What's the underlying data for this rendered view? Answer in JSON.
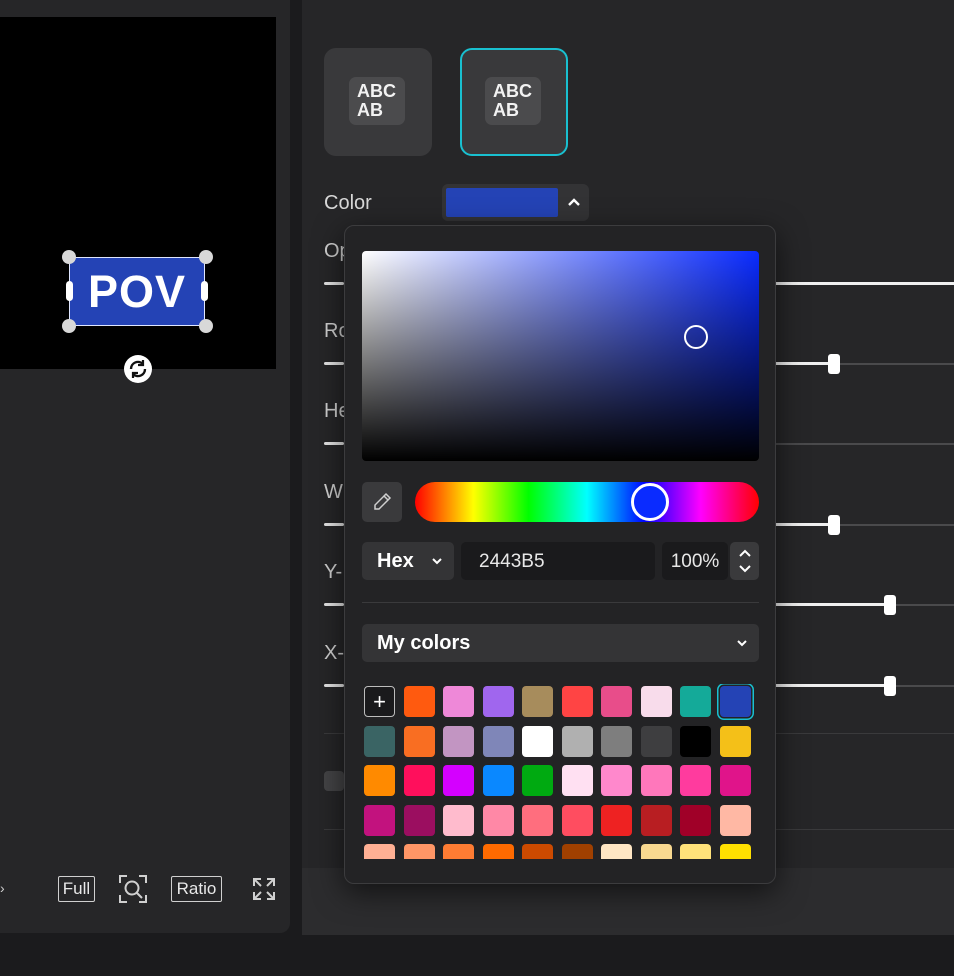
{
  "preview": {
    "text_element": "POV",
    "text_bg_color": "#2443B5",
    "buttons": {
      "full": "Full",
      "zoom": "zoom-fit",
      "ratio": "Ratio",
      "fullscreen": "fullscreen"
    }
  },
  "properties": {
    "style_tiles": [
      {
        "label_line1": "ABC",
        "label_line2": "AB",
        "selected": false
      },
      {
        "label_line1": "ABC",
        "label_line2": "AB",
        "selected": true
      }
    ],
    "color_label": "Color",
    "color_value": "#2443B5",
    "partial_labels": [
      "Op",
      "Ro",
      "He",
      "W",
      "Y-",
      "X-"
    ]
  },
  "color_picker": {
    "format": "Hex",
    "hex_value": "2443B5",
    "alpha": "100%",
    "palette_label": "My colors",
    "add_label": "+",
    "swatches": [
      [
        "#FF5A0F",
        "#EE88D8",
        "#A066EE",
        "#A78C5C",
        "#FF4444",
        "#E84D8A",
        "#F8DCEB",
        "#14AA99",
        "#2443B5"
      ],
      [
        "#3A6464",
        "#F96E22",
        "#C295C2",
        "#7F86B8",
        "#FFFFFF",
        "#B0B0B0",
        "#7E7E7E",
        "#3E3E40",
        "#000000",
        "#F4C018"
      ],
      [
        "#FF8A00",
        "#FF0F5C",
        "#D400FF",
        "#0A88FF",
        "#00AA11",
        "#FFE0F2",
        "#FF88CC",
        "#FF77BB",
        "#FF3B9E",
        "#E0148A"
      ],
      [
        "#C2127E",
        "#9B0E60",
        "#FFBBCD",
        "#FF88A6",
        "#FF6E7E",
        "#FF4D60",
        "#EE2222",
        "#B81E22",
        "#A00028",
        "#FFB8A4"
      ],
      [
        "#FFB094",
        "#FF9666",
        "#FF7C33",
        "#FF6A00",
        "#CC4A00",
        "#A04000",
        "#FFE6C4",
        "#F8D890",
        "#FFE27A",
        "#FFE000"
      ]
    ]
  }
}
